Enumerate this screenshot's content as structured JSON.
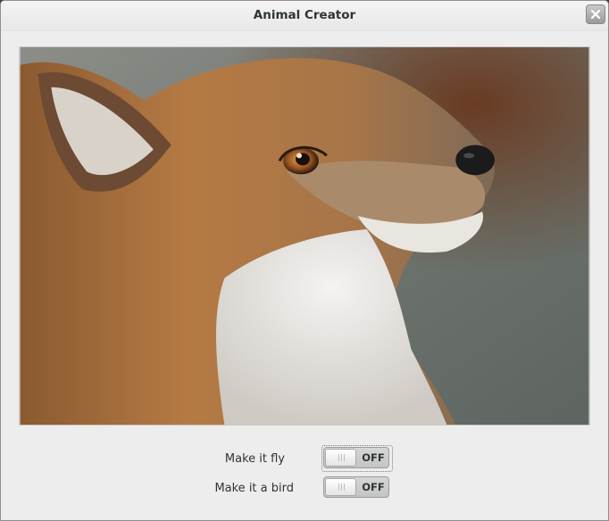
{
  "window": {
    "title": "Animal Creator",
    "close_icon": "close-icon"
  },
  "content": {
    "image": "fox-photo",
    "switches": [
      {
        "label": "Make it fly",
        "state": "OFF",
        "focused": true
      },
      {
        "label": "Make it a bird",
        "state": "OFF",
        "focused": false
      }
    ]
  }
}
